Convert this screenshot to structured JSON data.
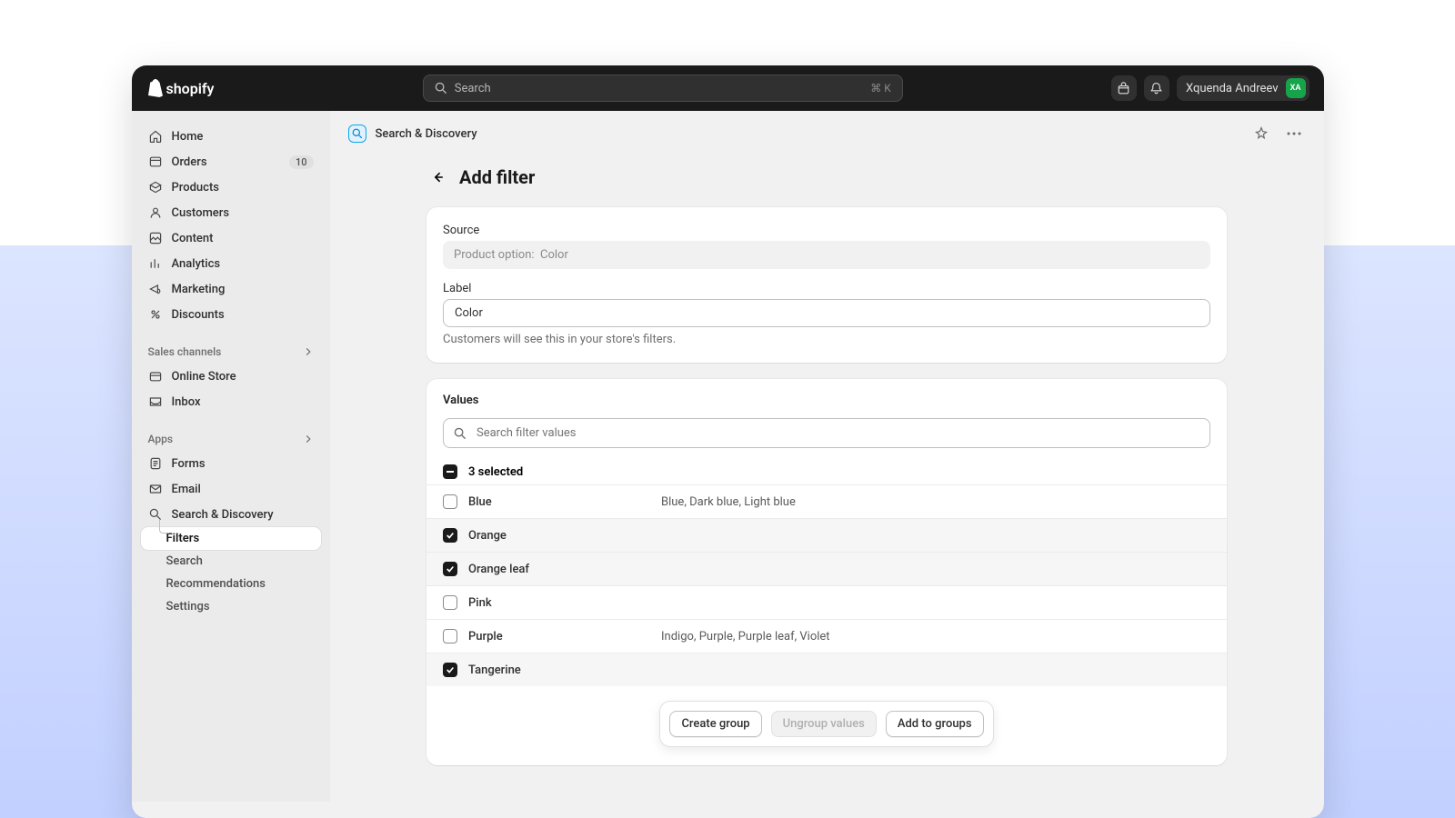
{
  "topbar": {
    "brand": "shopify",
    "search_placeholder": "Search",
    "shortcut": "⌘ K",
    "user_name": "Xquenda Andreev",
    "user_initials": "XA"
  },
  "sidebar": {
    "main": [
      {
        "label": "Home"
      },
      {
        "label": "Orders",
        "badge": "10"
      },
      {
        "label": "Products"
      },
      {
        "label": "Customers"
      },
      {
        "label": "Content"
      },
      {
        "label": "Analytics"
      },
      {
        "label": "Marketing"
      },
      {
        "label": "Discounts"
      }
    ],
    "channels_head": "Sales channels",
    "channels": [
      {
        "label": "Online Store"
      },
      {
        "label": "Inbox"
      }
    ],
    "apps_head": "Apps",
    "apps": [
      {
        "label": "Forms"
      },
      {
        "label": "Email"
      },
      {
        "label": "Search & Discovery"
      }
    ],
    "sd_children": [
      {
        "label": "Filters",
        "active": true
      },
      {
        "label": "Search"
      },
      {
        "label": "Recommendations"
      },
      {
        "label": "Settings"
      }
    ]
  },
  "header": {
    "app_name": "Search & Discovery"
  },
  "page": {
    "title": "Add filter",
    "source_label": "Source",
    "source_prefix": "Product option:",
    "source_value": "Color",
    "label_label": "Label",
    "label_value": "Color",
    "label_helper": "Customers will see this in your store's filters.",
    "values_label": "Values",
    "search_placeholder": "Search filter values",
    "selected_text": "3 selected",
    "rows": [
      {
        "name": "Blue",
        "extra": "Blue, Dark blue, Light blue",
        "checked": false
      },
      {
        "name": "Orange",
        "extra": "",
        "checked": true
      },
      {
        "name": "Orange leaf",
        "extra": "",
        "checked": true
      },
      {
        "name": "Pink",
        "extra": "",
        "checked": false
      },
      {
        "name": "Purple",
        "extra": "Indigo, Purple, Purple leaf, Violet",
        "checked": false
      },
      {
        "name": "Tangerine",
        "extra": "",
        "checked": true
      }
    ],
    "actions": {
      "create": "Create group",
      "ungroup": "Ungroup values",
      "add": "Add to groups"
    }
  }
}
